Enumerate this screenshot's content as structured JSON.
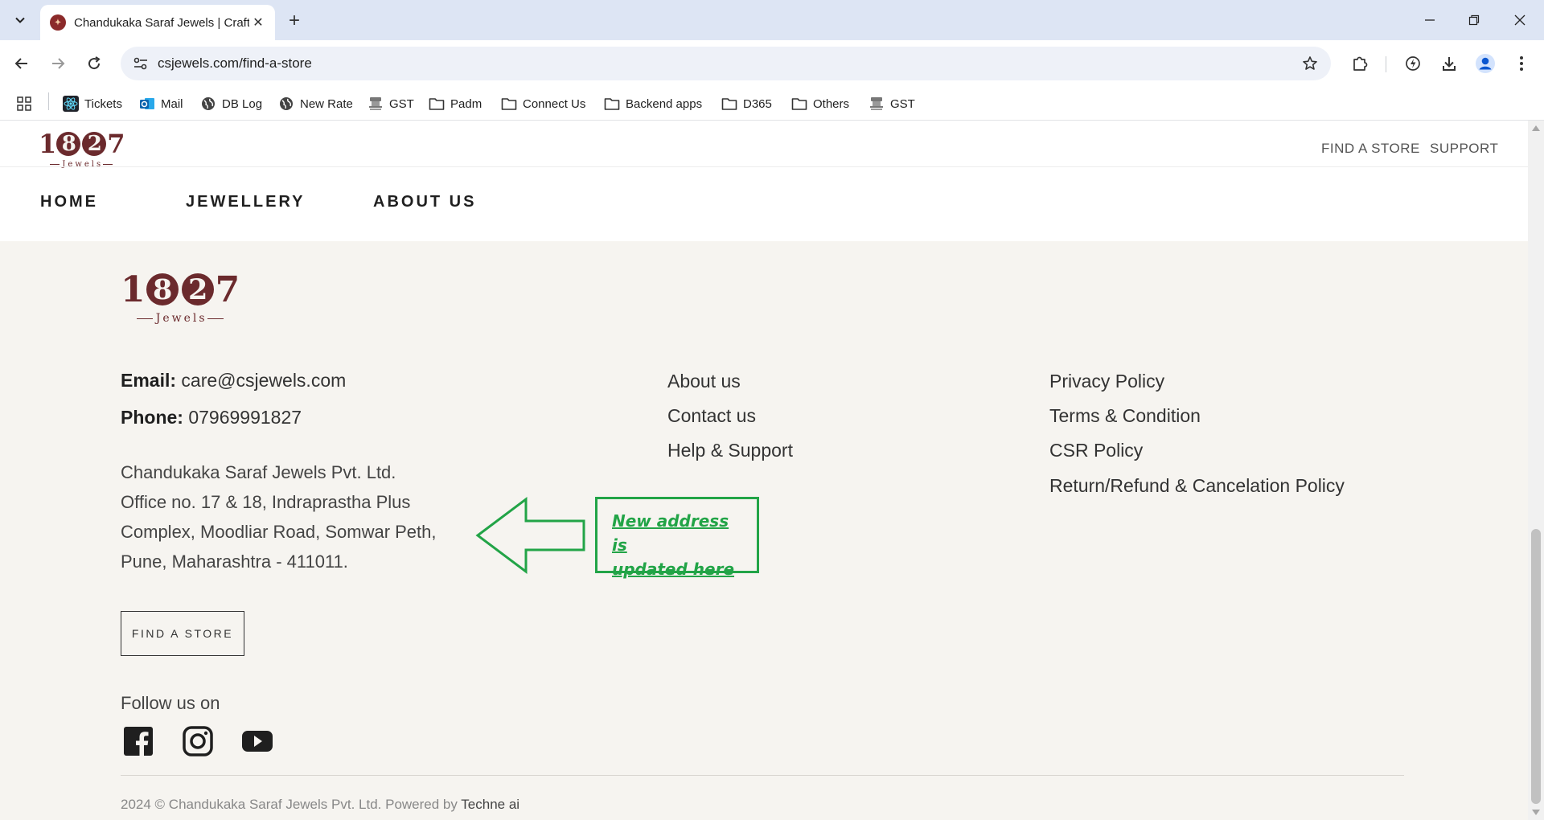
{
  "browser": {
    "tab_title": "Chandukaka Saraf Jewels | Craft",
    "url": "csjewels.com/find-a-store",
    "bookmarks": [
      {
        "label": "Tickets",
        "icon": "react-icon"
      },
      {
        "label": "Mail",
        "icon": "outlook-icon"
      },
      {
        "label": "DB Log",
        "icon": "globe-icon"
      },
      {
        "label": "New Rate",
        "icon": "globe-icon"
      },
      {
        "label": "GST",
        "icon": "emblem-icon"
      },
      {
        "label": "Padm",
        "icon": "folder-icon"
      },
      {
        "label": "Connect Us",
        "icon": "folder-icon"
      },
      {
        "label": "Backend apps",
        "icon": "folder-icon"
      },
      {
        "label": "D365",
        "icon": "folder-icon"
      },
      {
        "label": "Others",
        "icon": "folder-icon"
      },
      {
        "label": "GST",
        "icon": "emblem-icon"
      }
    ]
  },
  "logo": {
    "digits_a": "1",
    "digit_8": "8",
    "digit_2": "2",
    "digits_b": "7",
    "tag": "Jewels"
  },
  "header": {
    "top_links": [
      "FIND A STORE",
      "SUPPORT"
    ],
    "nav": [
      "HOME",
      "JEWELLERY",
      "ABOUT US"
    ]
  },
  "footer": {
    "email_label": "Email:",
    "email": "care@csjewels.com",
    "phone_label": "Phone:",
    "phone": "07969991827",
    "address_lines": [
      "Chandukaka Saraf Jewels Pvt. Ltd.",
      "Office no. 17 & 18, Indraprastha Plus",
      "Complex, Moodliar Road, Somwar Peth,",
      "Pune, Maharashtra - 411011."
    ],
    "links_col1": [
      "About us",
      "Contact us",
      "Help & Support"
    ],
    "links_col2": [
      "Privacy Policy",
      "Terms & Condition",
      "CSR Policy",
      "Return/Refund & Cancelation Policy"
    ],
    "find_store_button": "FIND A STORE",
    "follow_label": "Follow us on",
    "social": [
      "facebook-icon",
      "instagram-icon",
      "youtube-icon"
    ],
    "copyright": "2024 © Chandukaka Saraf Jewels Pvt. Ltd. Powered by",
    "powered_by": "Techne ai"
  },
  "annotation": {
    "line1": "New address is",
    "line2": "updated here",
    "color": "#22a447"
  }
}
